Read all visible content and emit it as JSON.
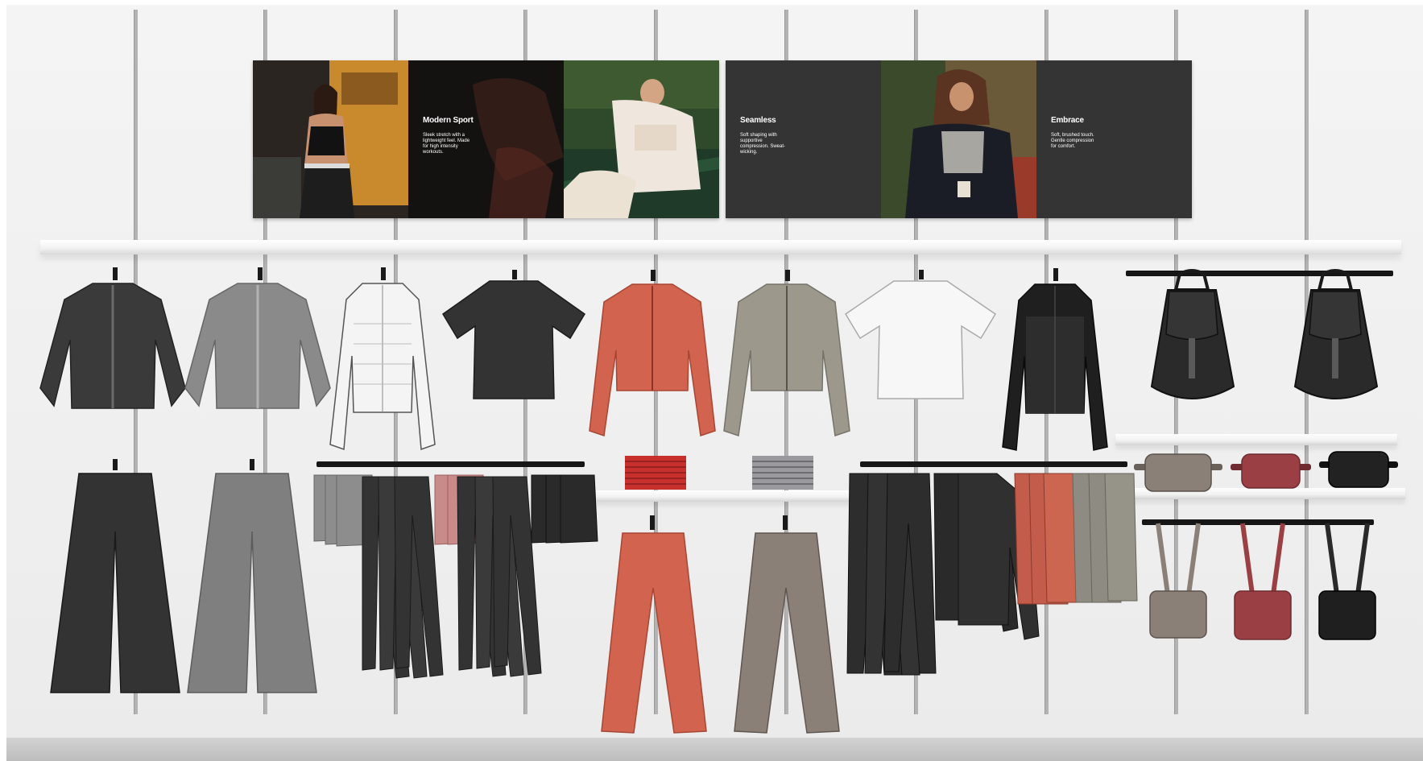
{
  "panels": [
    {
      "title": "Modern Sport",
      "body": "Sleek stretch with a lightweight feel. Made for high intensity workouts."
    },
    {
      "title": "Seamless",
      "body": "Soft shaping with supportive compression. Sweat-wicking."
    },
    {
      "title": "Embrace",
      "body": "Soft, brushed touch. Gentle compression for comfort."
    }
  ],
  "colors": {
    "panel_bg": "#2f2f2f",
    "charcoal": "#3a3a3a",
    "grey": "#8a8a8a",
    "white_garment": "#f2f2f2",
    "coral": "#d1634f",
    "sage": "#9c998c",
    "taupe": "#8b8078",
    "burgundy": "#9a3f44",
    "black": "#1f1f1f"
  }
}
